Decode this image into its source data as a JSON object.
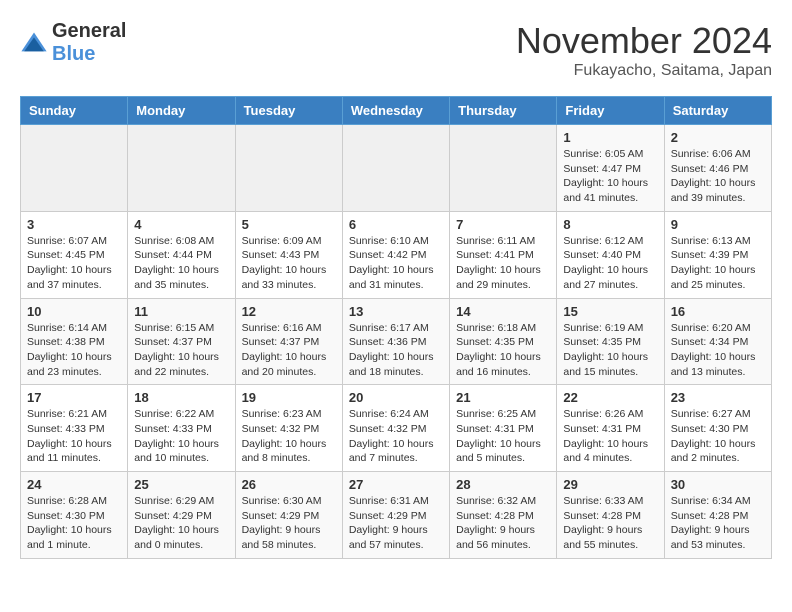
{
  "logo": {
    "general": "General",
    "blue": "Blue"
  },
  "title": "November 2024",
  "location": "Fukayacho, Saitama, Japan",
  "headers": [
    "Sunday",
    "Monday",
    "Tuesday",
    "Wednesday",
    "Thursday",
    "Friday",
    "Saturday"
  ],
  "weeks": [
    [
      {
        "day": "",
        "info": ""
      },
      {
        "day": "",
        "info": ""
      },
      {
        "day": "",
        "info": ""
      },
      {
        "day": "",
        "info": ""
      },
      {
        "day": "",
        "info": ""
      },
      {
        "day": "1",
        "info": "Sunrise: 6:05 AM\nSunset: 4:47 PM\nDaylight: 10 hours and 41 minutes."
      },
      {
        "day": "2",
        "info": "Sunrise: 6:06 AM\nSunset: 4:46 PM\nDaylight: 10 hours and 39 minutes."
      }
    ],
    [
      {
        "day": "3",
        "info": "Sunrise: 6:07 AM\nSunset: 4:45 PM\nDaylight: 10 hours and 37 minutes."
      },
      {
        "day": "4",
        "info": "Sunrise: 6:08 AM\nSunset: 4:44 PM\nDaylight: 10 hours and 35 minutes."
      },
      {
        "day": "5",
        "info": "Sunrise: 6:09 AM\nSunset: 4:43 PM\nDaylight: 10 hours and 33 minutes."
      },
      {
        "day": "6",
        "info": "Sunrise: 6:10 AM\nSunset: 4:42 PM\nDaylight: 10 hours and 31 minutes."
      },
      {
        "day": "7",
        "info": "Sunrise: 6:11 AM\nSunset: 4:41 PM\nDaylight: 10 hours and 29 minutes."
      },
      {
        "day": "8",
        "info": "Sunrise: 6:12 AM\nSunset: 4:40 PM\nDaylight: 10 hours and 27 minutes."
      },
      {
        "day": "9",
        "info": "Sunrise: 6:13 AM\nSunset: 4:39 PM\nDaylight: 10 hours and 25 minutes."
      }
    ],
    [
      {
        "day": "10",
        "info": "Sunrise: 6:14 AM\nSunset: 4:38 PM\nDaylight: 10 hours and 23 minutes."
      },
      {
        "day": "11",
        "info": "Sunrise: 6:15 AM\nSunset: 4:37 PM\nDaylight: 10 hours and 22 minutes."
      },
      {
        "day": "12",
        "info": "Sunrise: 6:16 AM\nSunset: 4:37 PM\nDaylight: 10 hours and 20 minutes."
      },
      {
        "day": "13",
        "info": "Sunrise: 6:17 AM\nSunset: 4:36 PM\nDaylight: 10 hours and 18 minutes."
      },
      {
        "day": "14",
        "info": "Sunrise: 6:18 AM\nSunset: 4:35 PM\nDaylight: 10 hours and 16 minutes."
      },
      {
        "day": "15",
        "info": "Sunrise: 6:19 AM\nSunset: 4:35 PM\nDaylight: 10 hours and 15 minutes."
      },
      {
        "day": "16",
        "info": "Sunrise: 6:20 AM\nSunset: 4:34 PM\nDaylight: 10 hours and 13 minutes."
      }
    ],
    [
      {
        "day": "17",
        "info": "Sunrise: 6:21 AM\nSunset: 4:33 PM\nDaylight: 10 hours and 11 minutes."
      },
      {
        "day": "18",
        "info": "Sunrise: 6:22 AM\nSunset: 4:33 PM\nDaylight: 10 hours and 10 minutes."
      },
      {
        "day": "19",
        "info": "Sunrise: 6:23 AM\nSunset: 4:32 PM\nDaylight: 10 hours and 8 minutes."
      },
      {
        "day": "20",
        "info": "Sunrise: 6:24 AM\nSunset: 4:32 PM\nDaylight: 10 hours and 7 minutes."
      },
      {
        "day": "21",
        "info": "Sunrise: 6:25 AM\nSunset: 4:31 PM\nDaylight: 10 hours and 5 minutes."
      },
      {
        "day": "22",
        "info": "Sunrise: 6:26 AM\nSunset: 4:31 PM\nDaylight: 10 hours and 4 minutes."
      },
      {
        "day": "23",
        "info": "Sunrise: 6:27 AM\nSunset: 4:30 PM\nDaylight: 10 hours and 2 minutes."
      }
    ],
    [
      {
        "day": "24",
        "info": "Sunrise: 6:28 AM\nSunset: 4:30 PM\nDaylight: 10 hours and 1 minute."
      },
      {
        "day": "25",
        "info": "Sunrise: 6:29 AM\nSunset: 4:29 PM\nDaylight: 10 hours and 0 minutes."
      },
      {
        "day": "26",
        "info": "Sunrise: 6:30 AM\nSunset: 4:29 PM\nDaylight: 9 hours and 58 minutes."
      },
      {
        "day": "27",
        "info": "Sunrise: 6:31 AM\nSunset: 4:29 PM\nDaylight: 9 hours and 57 minutes."
      },
      {
        "day": "28",
        "info": "Sunrise: 6:32 AM\nSunset: 4:28 PM\nDaylight: 9 hours and 56 minutes."
      },
      {
        "day": "29",
        "info": "Sunrise: 6:33 AM\nSunset: 4:28 PM\nDaylight: 9 hours and 55 minutes."
      },
      {
        "day": "30",
        "info": "Sunrise: 6:34 AM\nSunset: 4:28 PM\nDaylight: 9 hours and 53 minutes."
      }
    ]
  ]
}
